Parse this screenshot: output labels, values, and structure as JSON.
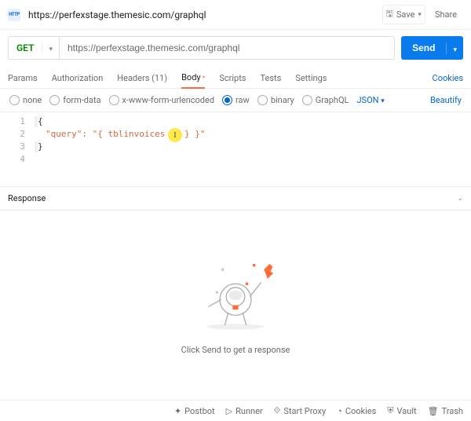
{
  "topbar": {
    "url": "https://perfexstage.themesic.com/graphql",
    "save_label": "Save",
    "share_label": "Share",
    "http_abbrev": "HTTP"
  },
  "request": {
    "method": "GET",
    "url": "https://perfexstage.themesic.com/graphql",
    "send_label": "Send"
  },
  "tabs": {
    "params": "Params",
    "authorization": "Authorization",
    "headers_label": "Headers (11)",
    "body": "Body",
    "scripts": "Scripts",
    "tests": "Tests",
    "settings": "Settings",
    "cookies": "Cookies"
  },
  "body_options": {
    "none": "none",
    "form_data": "form-data",
    "urlencoded": "x-www-form-urlencoded",
    "raw": "raw",
    "binary": "binary",
    "graphql": "GraphQL",
    "format_select": "JSON",
    "beautify": "Beautify"
  },
  "editor": {
    "line_numbers": [
      "1",
      "2",
      "3",
      "4"
    ],
    "line2_pre": "\"query\": \"{ tblinvoices ",
    "line2_cursor_spot": "{",
    "line2_post": " } }\""
  },
  "response": {
    "title": "Response",
    "hint": "Click Send to get a response"
  },
  "footer": {
    "postbot": "Postbot",
    "runner": "Runner",
    "start_proxy": "Start Proxy",
    "cookies": "Cookies",
    "vault": "Vault",
    "trash": "Trash"
  }
}
